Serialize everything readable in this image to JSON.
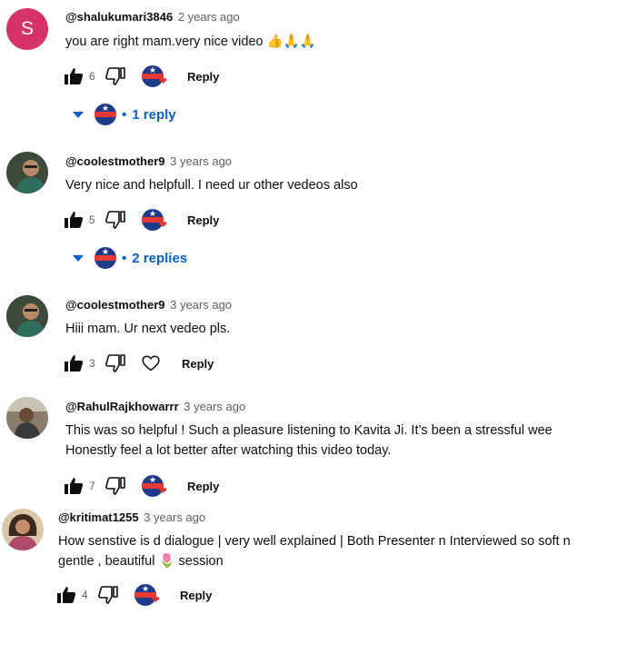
{
  "colors": {
    "link": "#065fd4",
    "avatar_s": "#d6336c",
    "heart": "#e53935"
  },
  "comments": [
    {
      "author": "@shalukumari3846",
      "time": "2 years ago",
      "lines": [
        "you are right mam.very nice video 👍🙏🙏"
      ],
      "likes": "6",
      "avatar_letter": "S",
      "creator_heart": true,
      "reply_label": "Reply",
      "replies_label": "1 reply"
    },
    {
      "author": "@coolestmother9",
      "time": "3 years ago",
      "lines": [
        "Very nice and helpfull. I need ur other vedeos also"
      ],
      "likes": "5",
      "creator_heart": true,
      "reply_label": "Reply",
      "replies_label": "2 replies"
    },
    {
      "author": "@coolestmother9",
      "time": "3 years ago",
      "lines": [
        "Hiii mam. Ur next vedeo pls."
      ],
      "likes": "3",
      "creator_heart": false,
      "reply_label": "Reply"
    },
    {
      "author": "@RahulRajkhowarrr",
      "time": "3 years ago",
      "lines": [
        "This was so helpful ! Such a pleasure listening to Kavita Ji. It’s been a stressful wee",
        "Honestly feel a lot better after watching this video today."
      ],
      "likes": "7",
      "creator_heart": true,
      "reply_label": "Reply"
    },
    {
      "author": "@kritimat1255",
      "time": "3 years ago",
      "lines": [
        "How senstive is d dialogue | very well explained | Both Presenter n Interviewed so soft n",
        "gentle , beautiful 🌷 session"
      ],
      "likes": "4",
      "creator_heart": true,
      "reply_label": "Reply"
    }
  ]
}
